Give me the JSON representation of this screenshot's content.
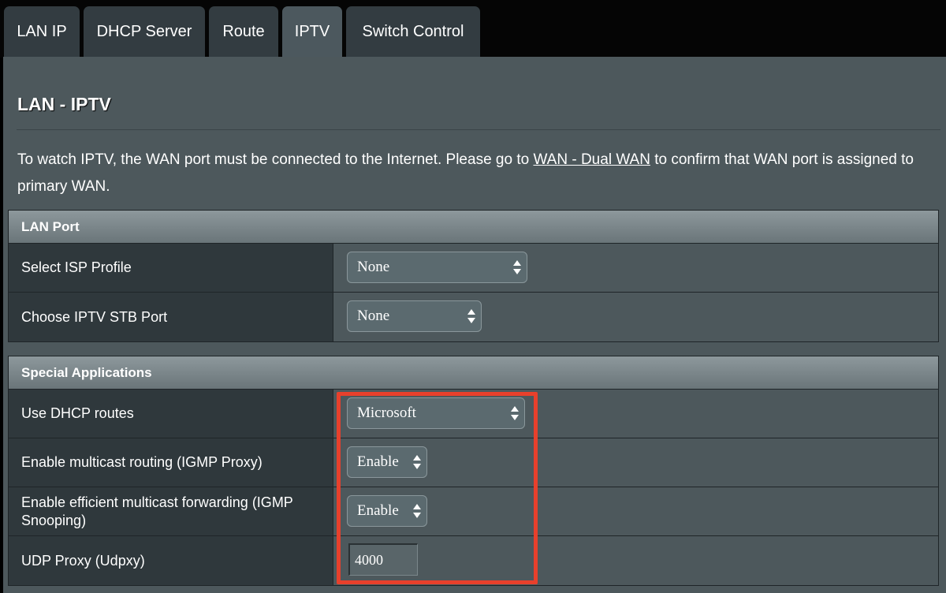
{
  "tabs": [
    {
      "label": "LAN IP",
      "active": false
    },
    {
      "label": "DHCP Server",
      "active": false
    },
    {
      "label": "Route",
      "active": false
    },
    {
      "label": "IPTV",
      "active": true
    },
    {
      "label": "Switch Control",
      "active": false
    }
  ],
  "page": {
    "title": "LAN - IPTV",
    "desc_before": "To watch IPTV, the WAN port must be connected to the Internet. Please go to ",
    "desc_link": "WAN - Dual WAN",
    "desc_after": " to confirm that WAN port is assigned to primary WAN."
  },
  "lan_port": {
    "header": "LAN Port",
    "isp_profile": {
      "label": "Select ISP Profile",
      "value": "None"
    },
    "stb_port": {
      "label": "Choose IPTV STB Port",
      "value": "None"
    }
  },
  "special_apps": {
    "header": "Special Applications",
    "dhcp_routes": {
      "label": "Use DHCP routes",
      "value": "Microsoft"
    },
    "multicast_routing": {
      "label": "Enable multicast routing (IGMP Proxy)",
      "value": "Enable"
    },
    "igmp_snooping": {
      "label": "Enable efficient multicast forwarding (IGMP Snooping)",
      "value": "Enable"
    },
    "udp_proxy": {
      "label": "UDP Proxy (Udpxy)",
      "value": "4000"
    }
  },
  "colors": {
    "highlight": "#e8402c",
    "panel": "#4d585c",
    "label_cell": "#2f383c",
    "active_tab": "#4c585e",
    "inactive_tab": "#333c41"
  }
}
